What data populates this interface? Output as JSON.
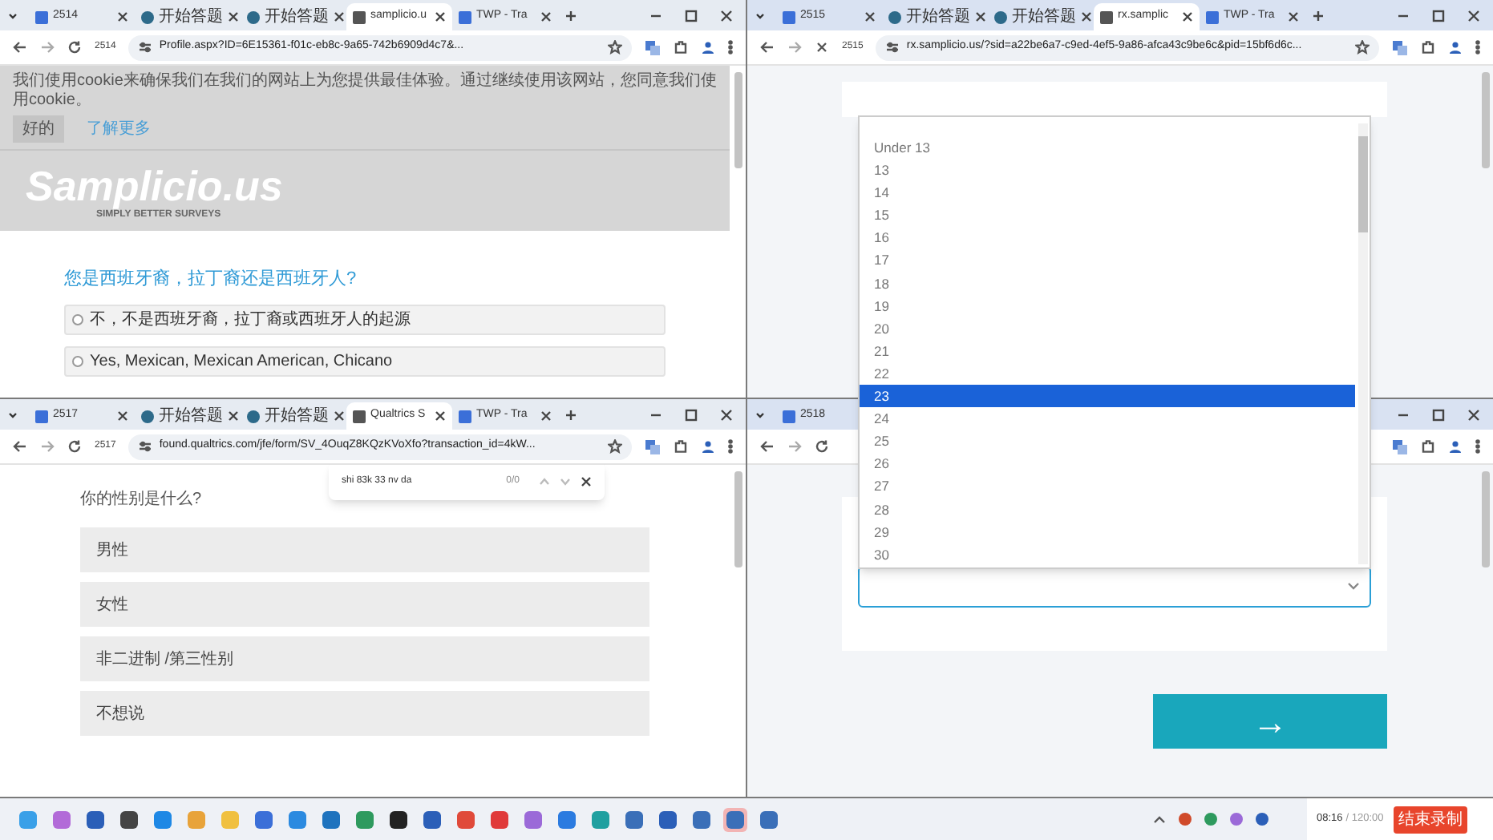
{
  "windows": [
    {
      "kind": "profile_survey",
      "active": false,
      "loading": false,
      "page_number": "2514",
      "url": "Profile.aspx?ID=6E15361-f01c-eb8c-9a65-742b6909d4c7&...",
      "tabs": [
        {
          "label": "2514",
          "selected": false
        },
        {
          "label": "开始答题",
          "selected": false
        },
        {
          "label": "开始答题",
          "selected": false
        },
        {
          "label": "samplicio.u",
          "selected": true
        },
        {
          "label": "TWP - Tra",
          "selected": false
        }
      ],
      "cookie_notice": {
        "text": "我们使用cookie来确保我们在我们的网站上为您提供最佳体验。通过继续使用该网站，您同意我们使用cookie。",
        "accept": "好的",
        "learn_more": "了解更多"
      },
      "logo": {
        "name": "Samplicio.us",
        "tagline": "SIMPLY BETTER SURVEYS"
      },
      "question": "您是西班牙裔，拉丁裔还是西班牙人?",
      "options": [
        {
          "label": "不，不是西班牙裔，拉丁裔或西班牙人的起源",
          "selected": false
        },
        {
          "label": "Yes, Mexican, Mexican American, Chicano",
          "selected": false
        }
      ]
    },
    {
      "kind": "age_survey_top",
      "active": true,
      "loading": true,
      "page_number": "2515",
      "url": "rx.samplicio.us/?sid=a22be6a7-c9ed-4ef5-9a86-afca43c9be6c&pid=15bf6d6c...",
      "tabs": [
        {
          "label": "2515",
          "selected": false
        },
        {
          "label": "开始答题",
          "selected": false
        },
        {
          "label": "开始答题",
          "selected": false
        },
        {
          "label": "rx.samplic",
          "selected": true
        },
        {
          "label": "TWP - Tra",
          "selected": false
        }
      ]
    },
    {
      "kind": "gender_survey",
      "active": false,
      "loading": false,
      "page_number": "2517",
      "url": "found.qualtrics.com/jfe/form/SV_4OuqZ8KQzKVoXfo?transaction_id=4kW...",
      "tabs": [
        {
          "label": "2517",
          "selected": false
        },
        {
          "label": "开始答题",
          "selected": false
        },
        {
          "label": "开始答题",
          "selected": false
        },
        {
          "label": "Qualtrics S",
          "selected": true
        },
        {
          "label": "TWP - Tra",
          "selected": false
        }
      ],
      "find_bar": {
        "query": "shi 83k 33 nv da",
        "count": "0/0"
      },
      "question": "你的性别是什么?",
      "options": [
        {
          "label": "男性",
          "selected": false
        },
        {
          "label": "女性",
          "selected": false
        },
        {
          "label": "非二进制 /第三性别",
          "selected": false
        },
        {
          "label": "不想说",
          "selected": false
        }
      ]
    },
    {
      "kind": "age_survey_bottom",
      "active": true,
      "loading": false,
      "tabs": [
        {
          "label": "2518",
          "selected": false
        }
      ],
      "next_button": "→"
    }
  ],
  "age_dropdown": {
    "options": [
      {
        "label": "Under 13",
        "selected": false
      },
      {
        "label": "13",
        "selected": false
      },
      {
        "label": "14",
        "selected": false
      },
      {
        "label": "15",
        "selected": false
      },
      {
        "label": "16",
        "selected": false
      },
      {
        "label": "17",
        "selected": false
      },
      {
        "label": "18",
        "selected": false
      },
      {
        "label": "19",
        "selected": false
      },
      {
        "label": "20",
        "selected": false
      },
      {
        "label": "21",
        "selected": false
      },
      {
        "label": "22",
        "selected": false
      },
      {
        "label": "23",
        "selected": true
      },
      {
        "label": "24",
        "selected": false
      },
      {
        "label": "25",
        "selected": false
      },
      {
        "label": "26",
        "selected": false
      },
      {
        "label": "27",
        "selected": false
      },
      {
        "label": "28",
        "selected": false
      },
      {
        "label": "29",
        "selected": false
      },
      {
        "label": "30",
        "selected": false
      }
    ]
  },
  "recorder": {
    "elapsed": "08:16",
    "limit": "/ 120:00",
    "stop_button": "结束录制"
  },
  "taskbar": {
    "apps": [
      {
        "selected": false
      },
      {
        "selected": false
      },
      {
        "selected": false
      },
      {
        "selected": false
      },
      {
        "selected": false
      },
      {
        "selected": false
      },
      {
        "selected": false
      },
      {
        "selected": false
      },
      {
        "selected": false
      },
      {
        "selected": false
      },
      {
        "selected": false
      },
      {
        "selected": false
      },
      {
        "selected": false
      },
      {
        "selected": false
      },
      {
        "selected": false
      },
      {
        "selected": false
      },
      {
        "selected": false
      },
      {
        "selected": false
      },
      {
        "selected": false
      },
      {
        "selected": false
      },
      {
        "selected": false
      },
      {
        "selected": true
      },
      {
        "selected": false
      }
    ]
  }
}
